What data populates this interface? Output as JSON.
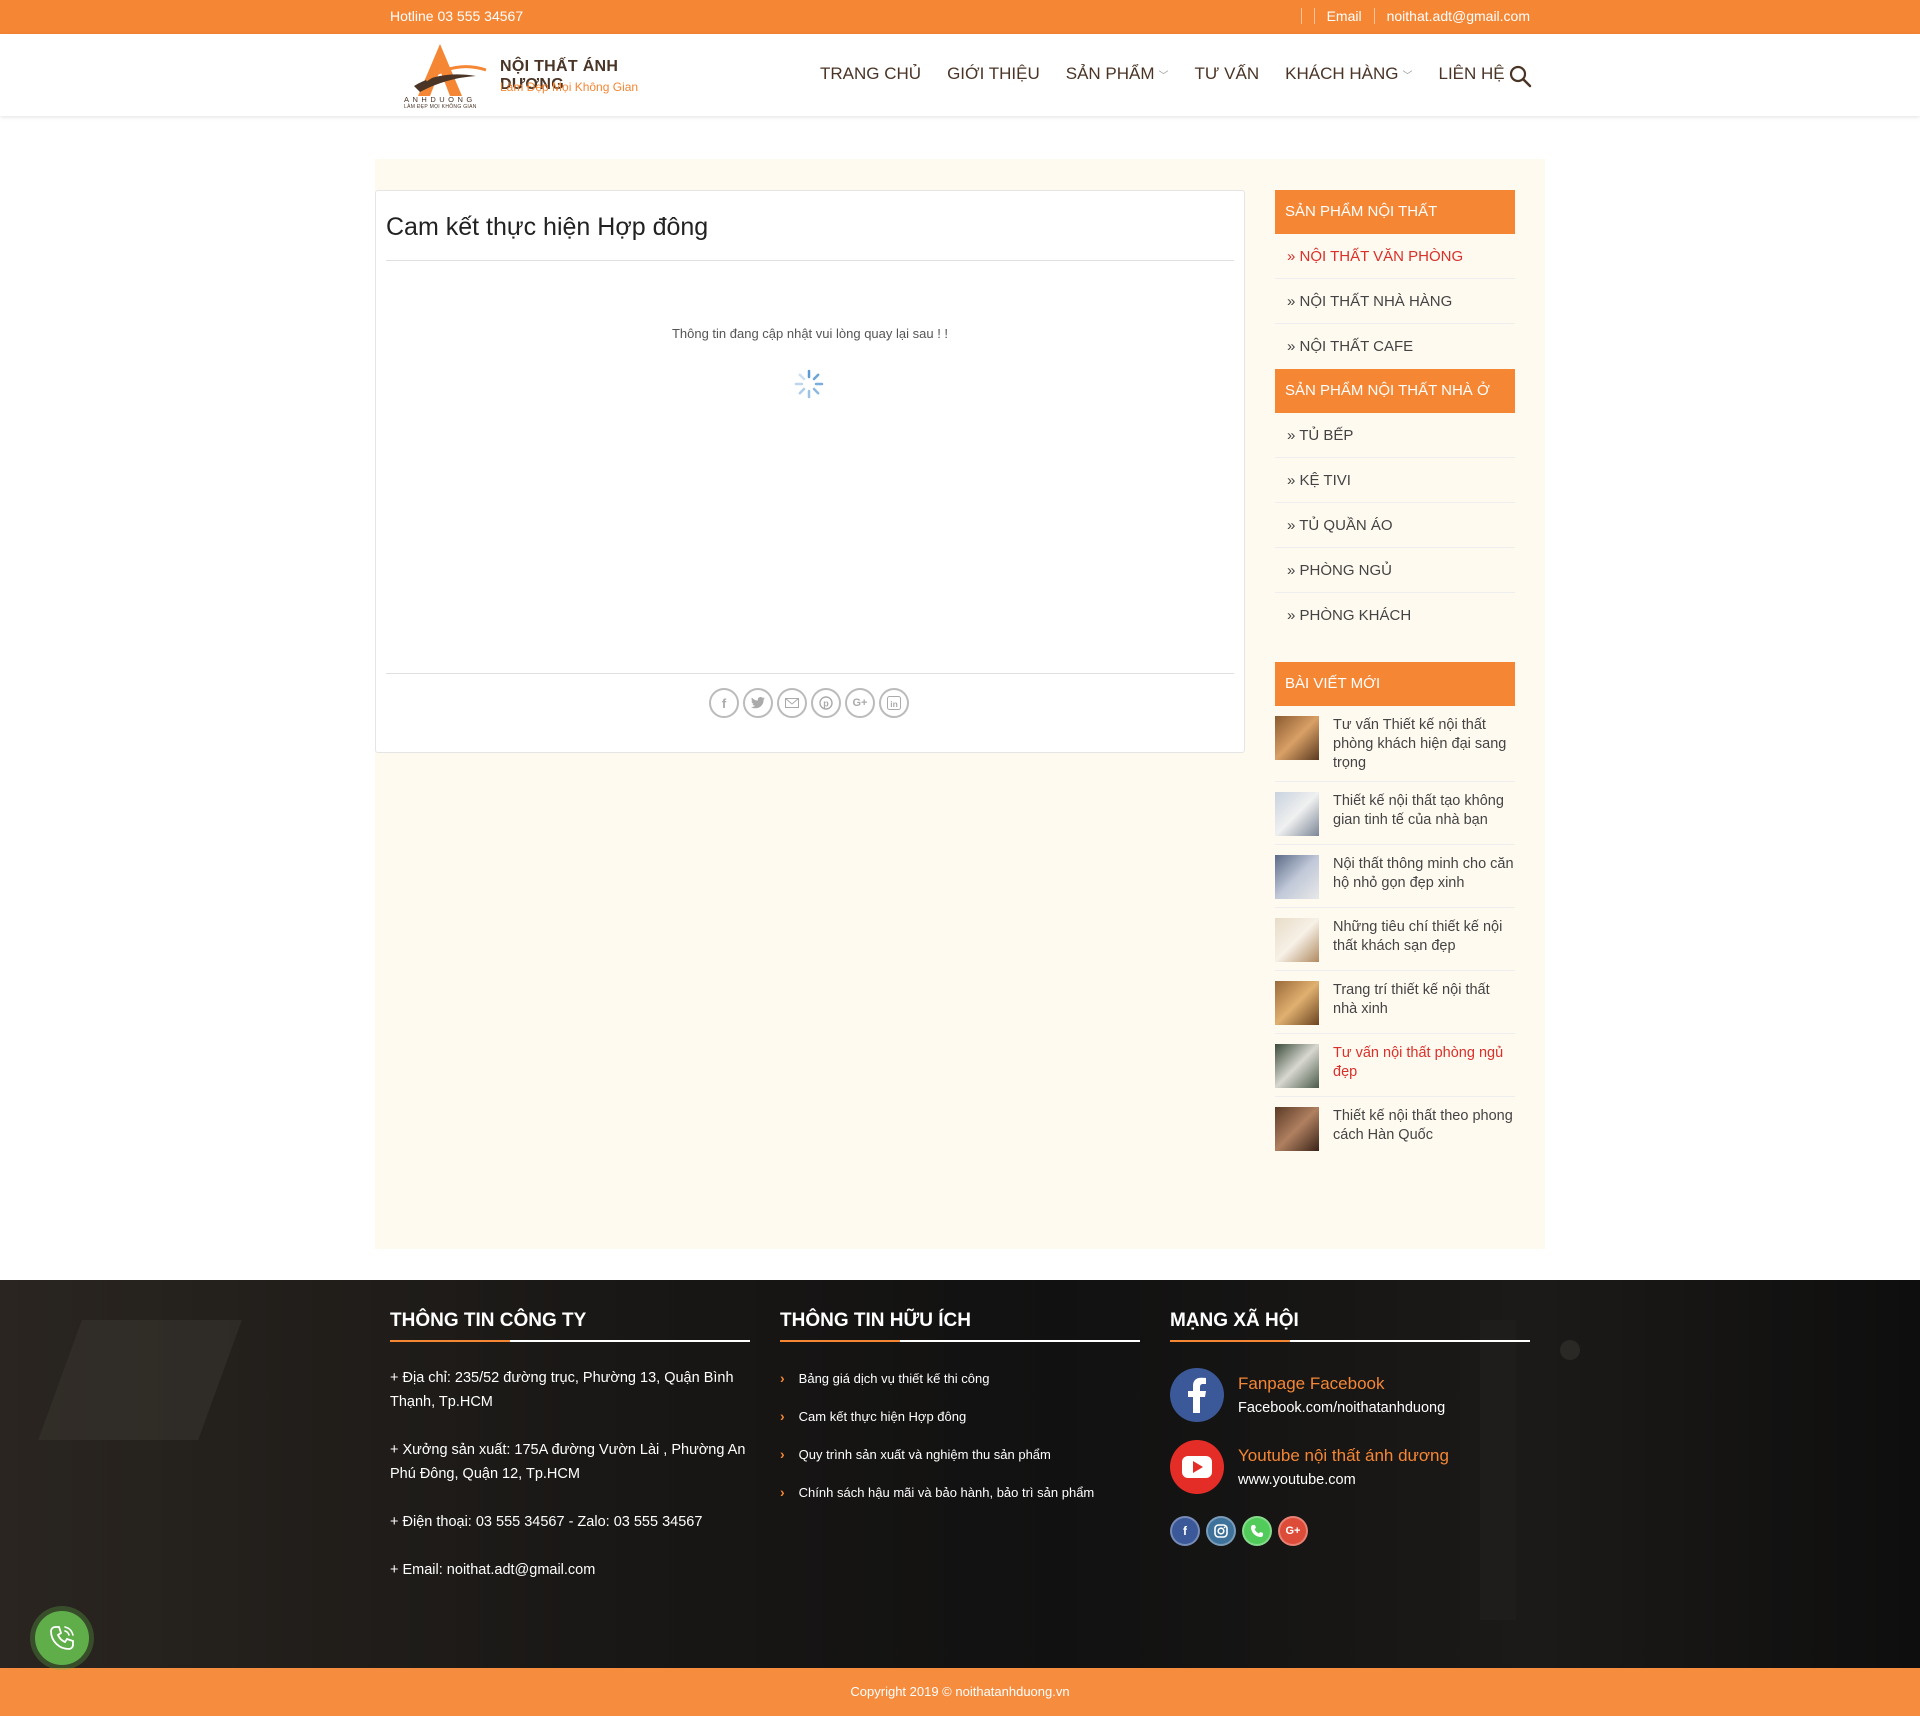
{
  "topbar": {
    "hotline": "Hotline 03 555 34567",
    "email_label": "Email",
    "email_value": "noithat.adt@gmail.com"
  },
  "header": {
    "logo_title": "NỘI THẤT ÁNH DƯƠNG",
    "logo_subtitle": "Làm Đẹp Mọi Không Gian",
    "logo_mark_text": "ANHDUONG",
    "logo_mark_sub": "LÀM ĐẸP MỌI KHÔNG GIAN",
    "nav": [
      {
        "label": "TRANG CHỦ"
      },
      {
        "label": "GIỚI THIỆU"
      },
      {
        "label": "SẢN PHẨM"
      },
      {
        "label": "TƯ VẤN"
      },
      {
        "label": "KHÁCH HÀNG"
      },
      {
        "label": "LIÊN HỆ"
      }
    ]
  },
  "article": {
    "title": "Cam kết thực hiện Hợp đông",
    "message": "Thông tin đang cập nhật vui lòng quay lại sau ! !",
    "share_icons": [
      "facebook-icon",
      "twitter-icon",
      "email-icon",
      "pinterest-icon",
      "google-plus-icon",
      "linkedin-icon"
    ]
  },
  "sidebar": {
    "section1_title": "SẢN PHẨM NỘI THẤT",
    "section1_items": [
      "» NỘI THẤT VĂN PHÒNG",
      "» NỘI THẤT NHÀ HÀNG",
      "» NỘI THẤT CAFE"
    ],
    "section2_title": "SẢN PHẨM NỘI THẤT NHÀ Ở",
    "section2_items": [
      "» TỦ BẾP",
      "» KỆ TIVI",
      "» TỦ QUẦN ÁO",
      "» PHÒNG NGỦ",
      "» PHÒNG KHÁCH"
    ],
    "section3_title": "BÀI VIẾT MỚI",
    "posts": [
      "Tư vấn Thiết kế nội thất phòng khách hiện đại sang trọng",
      "Thiết kế nội thất tạo không gian tinh tế của nhà bạn",
      "Nội thất thông minh cho căn hộ nhỏ gọn đẹp xinh",
      "Những tiêu chí thiết kế nội thất khách sạn đẹp",
      "Trang trí thiết kế nội thất nhà xinh",
      "Tư vấn nội thất phòng ngủ đẹp",
      "Thiết kế nội thất theo phong cách Hàn Quốc"
    ]
  },
  "footer": {
    "col1_title": "THÔNG TIN CÔNG TY",
    "address": "+ Địa chỉ: 235/52 đường trục, Phường 13, Quận Bình Thạnh, Tp.HCM",
    "factory": "+ Xưởng sản xuất: 175A đường Vườn Lài , Phường An Phú Đông, Quận 12, Tp.HCM",
    "phone": "+ Điện thoại: 03 555 34567   - Zalo: 03 555 34567",
    "email": "+ Email: noithat.adt@gmail.com",
    "col2_title": "THÔNG TIN HỮU ÍCH",
    "links": [
      "Bảng giá dịch vụ thiết kế thi công",
      "Cam kết thực hiện Hợp đông",
      "Quy trình sản xuất và nghiệm thu sản phẩm",
      "Chính sách hậu mãi và bảo hành, bảo trì sản phẩm"
    ],
    "col3_title": "MẠNG XÃ HỘI",
    "facebook_name": "Fanpage Facebook",
    "facebook_url": "Facebook.com/noithatanhduong",
    "youtube_name": "Youtube nội thất ánh dương",
    "youtube_url": "www.youtube.com",
    "copyright": "Copyright 2019 © noithatanhduong.vn"
  },
  "colors": {
    "brand": "#f58634",
    "active_link": "#d9302a",
    "call_button": "#5fae4a"
  }
}
